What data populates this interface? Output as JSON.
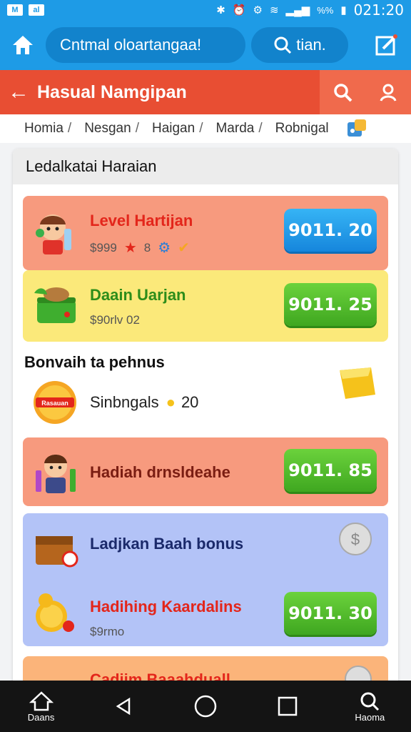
{
  "status": {
    "left_icon_1": "M",
    "left_icon_2": "al",
    "signal_text": "%%",
    "time": "021:20"
  },
  "topbar": {
    "title": "Cntmal oloartangaa!",
    "search_label": "tian."
  },
  "redbar": {
    "title": "Hasual Namgipan"
  },
  "breadcrumb": [
    "Homia",
    "Nesgan",
    "Haigan",
    "Marda",
    "Robnigal"
  ],
  "panel": {
    "header": "Ledalkatai Haraian",
    "cards": [
      {
        "name": "Level Hartijan",
        "sub": "$999",
        "sub_extra": "8",
        "button": "9011. 20"
      },
      {
        "name": "Daain Uarjan",
        "sub": "$90rlv 02",
        "button": "9011. 25"
      }
    ],
    "bonus_title": "Bonvaih ta pehnus",
    "badge_text": "Rasauan",
    "bonus_label": "Sinbngals",
    "bonus_count": "20",
    "card_hadiah": {
      "name": "Hadiah drnsldeahe",
      "button": "9011. 85"
    },
    "bonus_group": {
      "title": "Ladjkan Baah bonus",
      "item_name": "Hadihing Kaardalins",
      "item_sub": "$9rmo",
      "button": "9011. 30"
    },
    "partial_card": {
      "name": "Cadiim Baaahduall"
    }
  },
  "navbar": {
    "left_label": "Daans",
    "right_label": "Haoma"
  },
  "colors": {
    "primary_blue": "#1e9be6",
    "header_red": "#e84e33",
    "card_salmon": "#f79a7e",
    "card_yellow": "#fbe97a",
    "card_lavender": "#b3c3f7",
    "button_blue": "#1686dc",
    "button_green": "#3fa720"
  }
}
